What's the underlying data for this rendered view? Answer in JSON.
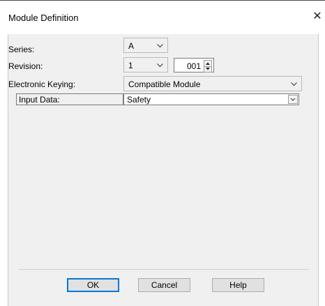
{
  "dialog": {
    "title": "Module Definition",
    "close_icon": "close-icon"
  },
  "form": {
    "series": {
      "label": "Series:",
      "value": "A"
    },
    "revision": {
      "label": "Revision:",
      "major": "1",
      "minor": "001"
    },
    "electronic_keying": {
      "label": "Electronic Keying:",
      "value": "Compatible Module"
    },
    "input_data": {
      "label": "Input Data:",
      "value": "Safety"
    }
  },
  "buttons": {
    "ok": "OK",
    "cancel": "Cancel",
    "help": "Help"
  },
  "colors": {
    "client_bg": "#f0f0f0",
    "default_button_border": "#0078d7"
  }
}
